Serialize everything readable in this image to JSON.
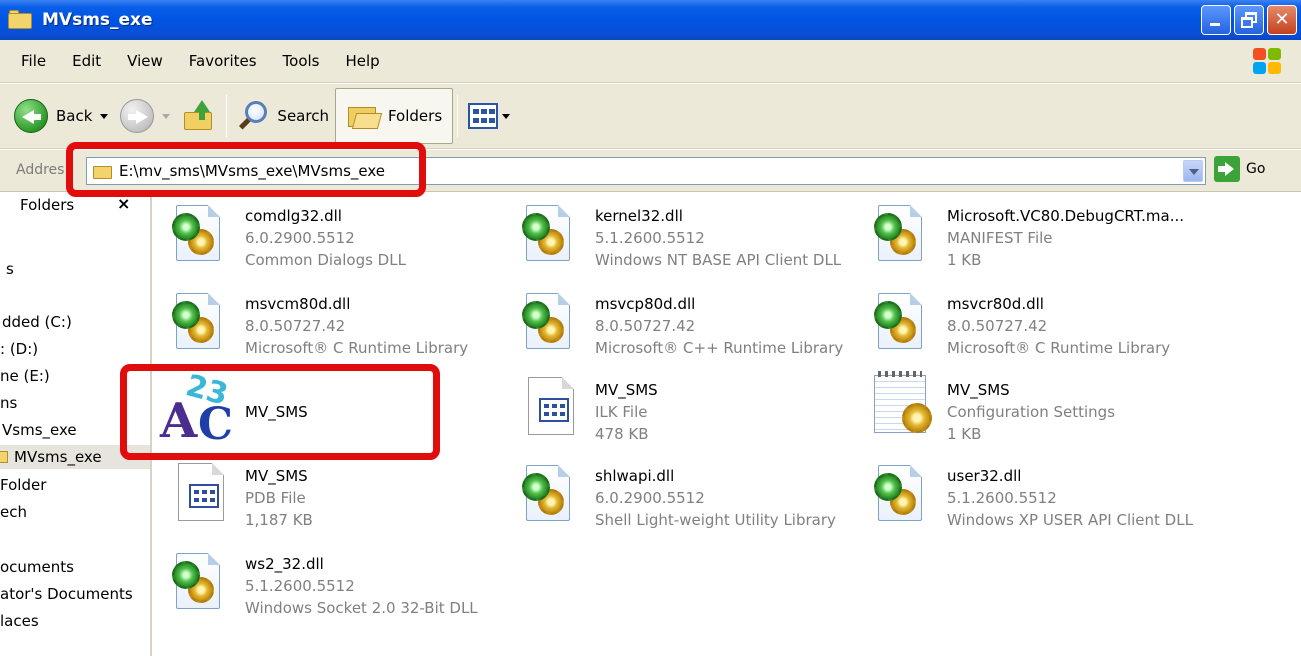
{
  "window": {
    "title": "MVsms_exe"
  },
  "menu": {
    "items": [
      "File",
      "Edit",
      "View",
      "Favorites",
      "Tools",
      "Help"
    ]
  },
  "toolbar": {
    "back_label": "Back",
    "search_label": "Search",
    "folders_label": "Folders"
  },
  "address": {
    "label": "Addres",
    "path": "E:\\mv_sms\\MVsms_exe\\MVsms_exe",
    "go_label": "Go"
  },
  "folders_pane": {
    "header": "Folders",
    "items": [
      "s",
      "dded (C:)",
      ": (D:)",
      "ne (E:)",
      "ns",
      "Vsms_exe",
      "MVsms_exe",
      "Folder",
      "ech",
      "ocuments",
      "ator's Documents",
      "laces"
    ]
  },
  "files": [
    {
      "name": "comdlg32.dll",
      "line2": "6.0.2900.5512",
      "line3": "Common Dialogs DLL",
      "icon": "dll-icon"
    },
    {
      "name": "kernel32.dll",
      "line2": "5.1.2600.5512",
      "line3": "Windows NT BASE API Client DLL",
      "icon": "dll-icon"
    },
    {
      "name": "Microsoft.VC80.DebugCRT.ma...",
      "line2": "MANIFEST File",
      "line3": "1 KB",
      "icon": "dll-icon"
    },
    {
      "name": "msvcm80d.dll",
      "line2": "8.0.50727.42",
      "line3": "Microsoft® C Runtime Library",
      "icon": "dll-icon"
    },
    {
      "name": "msvcp80d.dll",
      "line2": "8.0.50727.42",
      "line3": "Microsoft® C++ Runtime Library",
      "icon": "dll-icon"
    },
    {
      "name": "msvcr80d.dll",
      "line2": "8.0.50727.42",
      "line3": "Microsoft® C Runtime Library",
      "icon": "dll-icon"
    },
    {
      "name": "MV_SMS",
      "line2": "",
      "line3": "",
      "icon": "app-ac-icon"
    },
    {
      "name": "MV_SMS",
      "line2": "ILK File",
      "line3": "478 KB",
      "icon": "window-file-icon"
    },
    {
      "name": "MV_SMS",
      "line2": "Configuration Settings",
      "line3": "1 KB",
      "icon": "config-file-icon"
    },
    {
      "name": "MV_SMS",
      "line2": "PDB File",
      "line3": "1,187 KB",
      "icon": "window-file-icon"
    },
    {
      "name": "shlwapi.dll",
      "line2": "6.0.2900.5512",
      "line3": "Shell Light-weight Utility Library",
      "icon": "dll-icon"
    },
    {
      "name": "user32.dll",
      "line2": "5.1.2600.5512",
      "line3": "Windows XP USER API Client DLL",
      "icon": "dll-icon"
    },
    {
      "name": "ws2_32.dll",
      "line2": "5.1.2600.5512",
      "line3": "Windows Socket 2.0 32-Bit DLL",
      "icon": "dll-icon"
    }
  ],
  "colors": {
    "titlebar": "#0054e3",
    "chrome": "#ece9d8",
    "highlight": "#e10c0c",
    "secondary_text": "#808080"
  }
}
